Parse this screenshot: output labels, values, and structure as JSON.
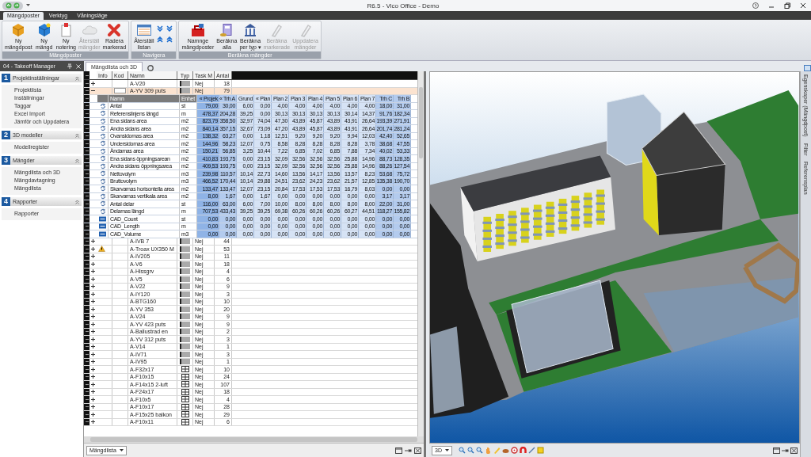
{
  "window": {
    "title": "R6.5 - Vico Office - Demo"
  },
  "ribbon": {
    "tabs": [
      {
        "label": "Mängdposter",
        "selected": true
      },
      {
        "label": "Verktyg",
        "selected": false
      },
      {
        "label": "Våningsläge",
        "selected": false
      }
    ],
    "groups": [
      {
        "label": "Mängdposter",
        "buttons": [
          {
            "kind": "box",
            "lines": [
              "Ny",
              "mängdpost"
            ],
            "disabled": false
          },
          {
            "kind": "cube",
            "lines": [
              "Ny",
              "mängd"
            ],
            "disabled": false
          },
          {
            "kind": "note",
            "lines": [
              "Ny",
              "notering"
            ],
            "disabled": false
          },
          {
            "kind": "cloud",
            "lines": [
              "Återställ",
              "mängder"
            ],
            "disabled": true
          },
          {
            "kind": "cross",
            "lines": [
              "Radera",
              "markerad"
            ],
            "disabled": false
          }
        ]
      },
      {
        "label": "Navigera",
        "buttons": [
          {
            "kind": "list",
            "lines": [
              "Återställ",
              "listan"
            ],
            "disabled": false
          }
        ],
        "arrows": true
      },
      {
        "label": "Beräkna mängder",
        "buttons": [
          {
            "kind": "toolbox",
            "lines": [
              "Namnge",
              "mängdposter"
            ],
            "disabled": false
          },
          {
            "kind": "calc",
            "lines": [
              "Beräkna",
              "alla"
            ],
            "disabled": false
          },
          {
            "kind": "columns",
            "lines": [
              "Beräkna",
              "per typ ▾"
            ],
            "disabled": false
          },
          {
            "kind": "pen",
            "lines": [
              "Beräkna",
              "markerade"
            ],
            "disabled": true
          },
          {
            "kind": "pen",
            "lines": [
              "Uppdatera",
              "mängder"
            ],
            "disabled": true
          }
        ]
      }
    ]
  },
  "panel": {
    "title": "04 - Takeoff Manager"
  },
  "sidebar": [
    {
      "number": "1",
      "title": "Projektinställningar",
      "items": [
        "Projektlista",
        "Inställningar",
        "Taggar",
        "Excel Import",
        "Jämför och Uppdatera"
      ]
    },
    {
      "number": "2",
      "title": "3D modeller",
      "items": [
        "Modellregister"
      ]
    },
    {
      "number": "3",
      "title": "Mängder",
      "items": [
        "Mängdlista och 3D",
        "Mängdavtagning",
        "Mängdlista"
      ]
    },
    {
      "number": "4",
      "title": "Rapporter",
      "items": [
        "Rapporter"
      ]
    }
  ],
  "document_tab": "Mängdlista och 3D",
  "table": {
    "columns": [
      "Info",
      "Kod",
      "Namn",
      "Typ",
      "Task M",
      "Antal"
    ],
    "rows": [
      {
        "name": "A-V20",
        "kind": "wall",
        "task": "Nej",
        "count": "18",
        "expanded": false,
        "selected": false,
        "warning": false
      },
      {
        "name": "A-YV 309 puts",
        "kind": "wall",
        "task": "Nej",
        "count": "79",
        "expanded": true,
        "selected": true,
        "warning": false,
        "sub_table": {
          "columns": [
            {
              "label": "Namn",
              "kind": "text"
            },
            {
              "label": "Enhet",
              "kind": "text"
            },
            {
              "label": "« Projek",
              "kind": "total"
            },
            {
              "label": "« Trh A",
              "kind": "house"
            },
            {
              "label": "Grund",
              "kind": "floor"
            },
            {
              "label": "« Plan",
              "kind": "floor"
            },
            {
              "label": "Plan 2",
              "kind": "floor"
            },
            {
              "label": "Plan 3",
              "kind": "floor"
            },
            {
              "label": "Plan 4",
              "kind": "floor"
            },
            {
              "label": "Plan 5",
              "kind": "floor"
            },
            {
              "label": "Plan 6",
              "kind": "floor"
            },
            {
              "label": "Plan 7",
              "kind": "floor"
            },
            {
              "label": "Trh C",
              "kind": "house"
            },
            {
              "label": "Trh B",
              "kind": "house"
            }
          ],
          "rows": [
            {
              "kind": "calc",
              "name": "Antal",
              "unit": "st",
              "values": [
                "79,00",
                "30,00",
                "6,00",
                "0,00",
                "4,00",
                "4,00",
                "4,00",
                "4,00",
                "4,00",
                "4,00",
                "18,00",
                "31,00"
              ]
            },
            {
              "kind": "calc",
              "name": "Referenslinjens längd",
              "unit": "m",
              "values": [
                "478,37",
                "204,28",
                "39,25",
                "0,00",
                "30,13",
                "30,13",
                "30,13",
                "30,13",
                "30,14",
                "14,37",
                "91,76",
                "182,34"
              ]
            },
            {
              "kind": "calc",
              "name": "Ena sidans area",
              "unit": "m2",
              "values": [
                "823,79",
                "358,50",
                "32,97",
                "74,04",
                "47,30",
                "43,89",
                "45,87",
                "43,89",
                "43,91",
                "26,64",
                "193,39",
                "271,91"
              ]
            },
            {
              "kind": "calc",
              "name": "Andra sidans area",
              "unit": "m2",
              "values": [
                "840,14",
                "357,15",
                "32,67",
                "73,09",
                "47,20",
                "43,89",
                "45,87",
                "43,89",
                "43,91",
                "26,64",
                "201,74",
                "281,24"
              ]
            },
            {
              "kind": "calc",
              "name": "Ovansidornas area",
              "unit": "m2",
              "values": [
                "138,32",
                "63,27",
                "0,00",
                "1,18",
                "12,51",
                "9,20",
                "9,20",
                "9,20",
                "9,94",
                "12,03",
                "42,40",
                "52,65"
              ]
            },
            {
              "kind": "calc",
              "name": "Undersidornas area",
              "unit": "m2",
              "values": [
                "144,96",
                "58,23",
                "12,07",
                "0,75",
                "8,58",
                "8,28",
                "8,28",
                "8,28",
                "8,28",
                "3,78",
                "38,68",
                "47,55"
              ]
            },
            {
              "kind": "calc",
              "name": "Ändarnas area",
              "unit": "m2",
              "values": [
                "150,21",
                "56,85",
                "3,25",
                "10,44",
                "7,22",
                "6,85",
                "7,02",
                "6,85",
                "7,88",
                "7,34",
                "40,02",
                "53,33"
              ]
            },
            {
              "kind": "calc",
              "name": "Ena sidans öppningsarean",
              "unit": "m2",
              "values": [
                "410,83",
                "193,75",
                "0,00",
                "23,15",
                "32,09",
                "32,56",
                "32,56",
                "32,56",
                "25,88",
                "14,96",
                "88,73",
                "128,35"
              ]
            },
            {
              "kind": "calc",
              "name": "Andra sidans öppningsarea",
              "unit": "m2",
              "values": [
                "409,53",
                "193,75",
                "0,00",
                "23,15",
                "32,09",
                "32,56",
                "32,56",
                "32,56",
                "25,88",
                "14,96",
                "88,26",
                "127,54"
              ]
            },
            {
              "kind": "calc",
              "name": "Nettovolym",
              "unit": "m3",
              "values": [
                "239,98",
                "110,57",
                "10,14",
                "22,73",
                "14,60",
                "13,56",
                "14,17",
                "13,56",
                "13,57",
                "8,23",
                "53,68",
                "75,72"
              ]
            },
            {
              "kind": "calc",
              "name": "Bruttovolym",
              "unit": "m3",
              "values": [
                "466,52",
                "170,44",
                "10,14",
                "29,88",
                "24,51",
                "23,62",
                "24,23",
                "23,62",
                "21,57",
                "12,85",
                "135,38",
                "190,70"
              ]
            },
            {
              "kind": "calc",
              "name": "Skarvarnas horisontella area",
              "unit": "m2",
              "values": [
                "133,47",
                "133,47",
                "12,07",
                "23,15",
                "20,84",
                "17,53",
                "17,53",
                "17,53",
                "16,79",
                "8,03",
                "0,00",
                "0,00"
              ]
            },
            {
              "kind": "calc",
              "name": "Skarvarnas vertikala area",
              "unit": "m2",
              "values": [
                "8,00",
                "1,67",
                "0,00",
                "1,67",
                "0,00",
                "0,00",
                "0,00",
                "0,00",
                "0,00",
                "0,00",
                "3,17",
                "3,17"
              ]
            },
            {
              "kind": "calc",
              "name": "Antal delar",
              "unit": "st",
              "values": [
                "116,00",
                "63,00",
                "6,00",
                "7,00",
                "10,00",
                "8,00",
                "8,00",
                "8,00",
                "8,00",
                "8,00",
                "22,00",
                "31,00"
              ]
            },
            {
              "kind": "calc",
              "name": "Delarnas längd",
              "unit": "m",
              "values": [
                "707,53",
                "433,43",
                "39,25",
                "39,25",
                "69,38",
                "60,26",
                "60,26",
                "60,26",
                "60,27",
                "44,51",
                "118,27",
                "155,82"
              ]
            },
            {
              "kind": "cad",
              "name": "CAD_Count",
              "unit": "st",
              "values": [
                "0,00",
                "0,00",
                "0,00",
                "0,00",
                "0,00",
                "0,00",
                "0,00",
                "0,00",
                "0,00",
                "0,00",
                "0,00",
                "0,00"
              ]
            },
            {
              "kind": "cad",
              "name": "CAD_Length",
              "unit": "m",
              "values": [
                "0,00",
                "0,00",
                "0,00",
                "0,00",
                "0,00",
                "0,00",
                "0,00",
                "0,00",
                "0,00",
                "0,00",
                "0,00",
                "0,00"
              ]
            },
            {
              "kind": "cad",
              "name": "CAD_Volume",
              "unit": "m3",
              "values": [
                "0,00",
                "0,00",
                "0,00",
                "0,00",
                "0,00",
                "0,00",
                "0,00",
                "0,00",
                "0,00",
                "0,00",
                "0,00",
                "0,00"
              ]
            }
          ]
        }
      },
      {
        "name": "A-IVB 7",
        "kind": "wall",
        "task": "Nej",
        "count": "44",
        "expanded": false,
        "selected": false,
        "warning": false
      },
      {
        "name": "A-Troax UX350 M",
        "kind": "wall",
        "task": "Nej",
        "count": "53",
        "expanded": false,
        "selected": false,
        "warning": true
      },
      {
        "name": "A-IV205",
        "kind": "wall",
        "task": "Nej",
        "count": "11",
        "expanded": false,
        "selected": false,
        "warning": false
      },
      {
        "name": "A-V6",
        "kind": "wall",
        "task": "Nej",
        "count": "18",
        "expanded": false,
        "selected": false,
        "warning": false
      },
      {
        "name": "A-Hissgrv",
        "kind": "wall",
        "task": "Nej",
        "count": "4",
        "expanded": false,
        "selected": false,
        "warning": false
      },
      {
        "name": "A-V5",
        "kind": "wall",
        "task": "Nej",
        "count": "6",
        "expanded": false,
        "selected": false,
        "warning": false
      },
      {
        "name": "A-V22",
        "kind": "wall",
        "task": "Nej",
        "count": "9",
        "expanded": false,
        "selected": false,
        "warning": false
      },
      {
        "name": "A-IY120",
        "kind": "wall",
        "task": "Nej",
        "count": "3",
        "expanded": false,
        "selected": false,
        "warning": false
      },
      {
        "name": "A-BTG160",
        "kind": "wall",
        "task": "Nej",
        "count": "10",
        "expanded": false,
        "selected": false,
        "warning": false
      },
      {
        "name": "A-YV 353",
        "kind": "wall",
        "task": "Nej",
        "count": "20",
        "expanded": false,
        "selected": false,
        "warning": false
      },
      {
        "name": "A-V24",
        "kind": "wall",
        "task": "Nej",
        "count": "9",
        "expanded": false,
        "selected": false,
        "warning": false
      },
      {
        "name": "A-YV 423 puts",
        "kind": "wall",
        "task": "Nej",
        "count": "9",
        "expanded": false,
        "selected": false,
        "warning": false
      },
      {
        "name": "A-Ballustrad en",
        "kind": "wall",
        "task": "Nej",
        "count": "2",
        "expanded": false,
        "selected": false,
        "warning": false
      },
      {
        "name": "A-YV 312 puts",
        "kind": "wall",
        "task": "Nej",
        "count": "3",
        "expanded": false,
        "selected": false,
        "warning": false
      },
      {
        "name": "A-V14",
        "kind": "wall",
        "task": "Nej",
        "count": "1",
        "expanded": false,
        "selected": false,
        "warning": false
      },
      {
        "name": "A-IV71",
        "kind": "wall",
        "task": "Nej",
        "count": "3",
        "expanded": false,
        "selected": false,
        "warning": false
      },
      {
        "name": "A-IV95",
        "kind": "wall",
        "task": "Nej",
        "count": "1",
        "expanded": false,
        "selected": false,
        "warning": false
      },
      {
        "name": "A-F32x17",
        "kind": "window",
        "task": "Nej",
        "count": "10",
        "expanded": false,
        "selected": false,
        "warning": false
      },
      {
        "name": "A-F10x15",
        "kind": "window",
        "task": "Nej",
        "count": "24",
        "expanded": false,
        "selected": false,
        "warning": false
      },
      {
        "name": "A-F14x15 2-luft",
        "kind": "window",
        "task": "Nej",
        "count": "107",
        "expanded": false,
        "selected": false,
        "warning": false
      },
      {
        "name": "A-F24x17",
        "kind": "window",
        "task": "Nej",
        "count": "18",
        "expanded": false,
        "selected": false,
        "warning": false
      },
      {
        "name": "A-F10x5",
        "kind": "window",
        "task": "Nej",
        "count": "4",
        "expanded": false,
        "selected": false,
        "warning": false
      },
      {
        "name": "A-F10x17",
        "kind": "window",
        "task": "Nej",
        "count": "28",
        "expanded": false,
        "selected": false,
        "warning": false
      },
      {
        "name": "A-F15x25 balkon",
        "kind": "window",
        "task": "Nej",
        "count": "29",
        "expanded": false,
        "selected": false,
        "warning": false
      },
      {
        "name": "A-F10x11",
        "kind": "window",
        "task": "Nej",
        "count": "6",
        "expanded": false,
        "selected": false,
        "warning": false
      }
    ]
  },
  "table_view": {
    "selector": "Mängdlista"
  },
  "view3d": {
    "selector": "3D"
  },
  "side_tabs": [
    "Egenskaper (Mängdpost)",
    "Filter",
    "Referensplan"
  ]
}
